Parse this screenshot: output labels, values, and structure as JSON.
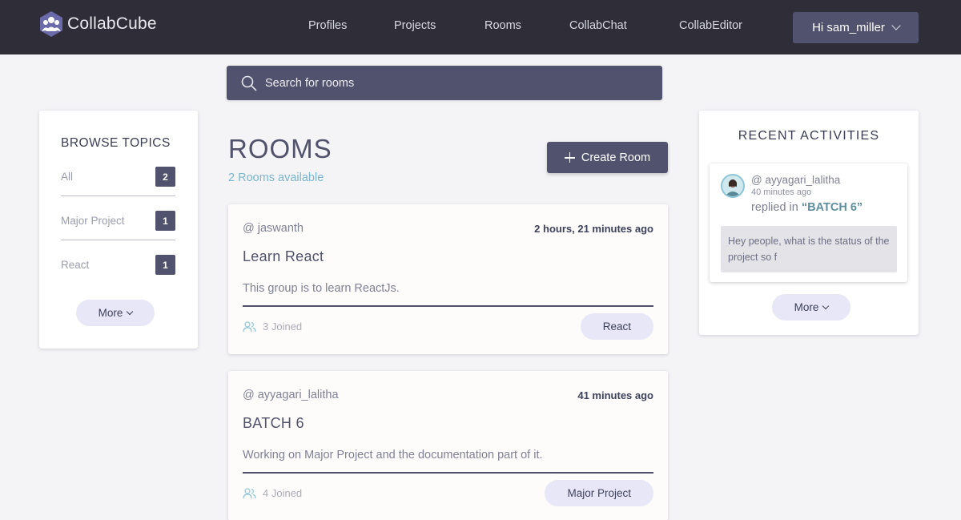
{
  "app": {
    "name": "CollabCube"
  },
  "nav": {
    "links": [
      "Profiles",
      "Projects",
      "Rooms",
      "CollabChat",
      "CollabEditor"
    ],
    "user_greeting": "Hi sam_miller"
  },
  "search": {
    "placeholder": "Search for rooms"
  },
  "topics": {
    "title": "BROWSE TOPICS",
    "items": [
      {
        "name": "All",
        "count": "2"
      },
      {
        "name": "Major Project",
        "count": "1"
      },
      {
        "name": "React",
        "count": "1"
      }
    ],
    "more_label": "More"
  },
  "rooms": {
    "title": "ROOMS",
    "subtitle": "2 Rooms available",
    "create_label": "Create Room",
    "items": [
      {
        "host": "@ jaswanth",
        "time": "2 hours, 21 minutes ago",
        "name": "Learn React",
        "description": "This group is to learn ReactJs.",
        "joined": "3 Joined",
        "topic": "React"
      },
      {
        "host": "@ ayyagari_lalitha",
        "time": "41 minutes ago",
        "name": "BATCH 6",
        "description": "Working on Major Project and the documentation part of it.",
        "joined": "4 Joined",
        "topic": "Major Project"
      }
    ]
  },
  "activities": {
    "title": "RECENT ACTIVITIES",
    "items": [
      {
        "user": "@ ayyagari_lalitha",
        "time": "40 minutes ago",
        "action": "replied in",
        "room": "“BATCH 6”",
        "message": "Hey people, what is the status of the project so f"
      }
    ],
    "more_label": "More"
  },
  "colors": {
    "header_bg": "#2e2d38",
    "accent": "#51536e",
    "link": "#7ab6cc",
    "pill_bg": "#e8e7f8"
  }
}
